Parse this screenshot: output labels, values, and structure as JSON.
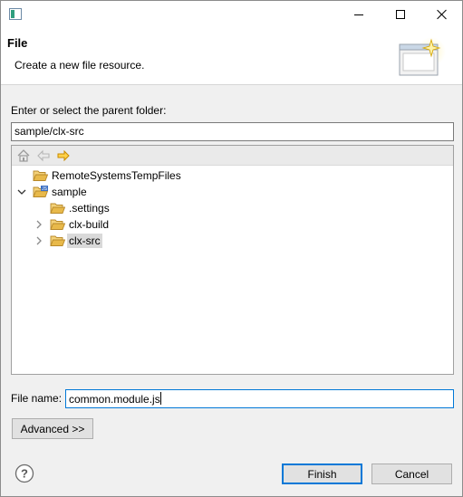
{
  "window": {
    "title_bar": {
      "minimize_glyph": "minimize",
      "maximize_glyph": "maximize",
      "close_glyph": "close"
    }
  },
  "banner": {
    "title": "File",
    "description": "Create a new file resource.",
    "icon": "new-file-wizard-icon"
  },
  "parent_folder": {
    "label": "Enter or select the parent folder:",
    "value": "sample/clx-src"
  },
  "tree": {
    "toolbar": {
      "home_icon": "home-icon",
      "back_icon": "back-arrow-icon",
      "forward_icon": "forward-arrow-icon"
    },
    "items": [
      {
        "label": "RemoteSystemsTempFiles",
        "depth": 0,
        "expander": "none",
        "icon": "folder-icon"
      },
      {
        "label": "sample",
        "depth": 0,
        "expander": "expanded",
        "icon": "js-project-folder-icon"
      },
      {
        "label": ".settings",
        "depth": 1,
        "expander": "none",
        "icon": "folder-icon"
      },
      {
        "label": "clx-build",
        "depth": 1,
        "expander": "collapsed",
        "icon": "folder-icon"
      },
      {
        "label": "clx-src",
        "depth": 1,
        "expander": "collapsed",
        "icon": "folder-icon",
        "selected": true
      }
    ]
  },
  "file_name": {
    "label": "File name:",
    "value": "common.module.js"
  },
  "buttons": {
    "advanced": "Advanced >>",
    "finish": "Finish",
    "cancel": "Cancel",
    "help_icon": "help-icon"
  },
  "colors": {
    "accent": "#0078d7",
    "folder": "#e8b94a",
    "arrow": "#e6a800"
  }
}
